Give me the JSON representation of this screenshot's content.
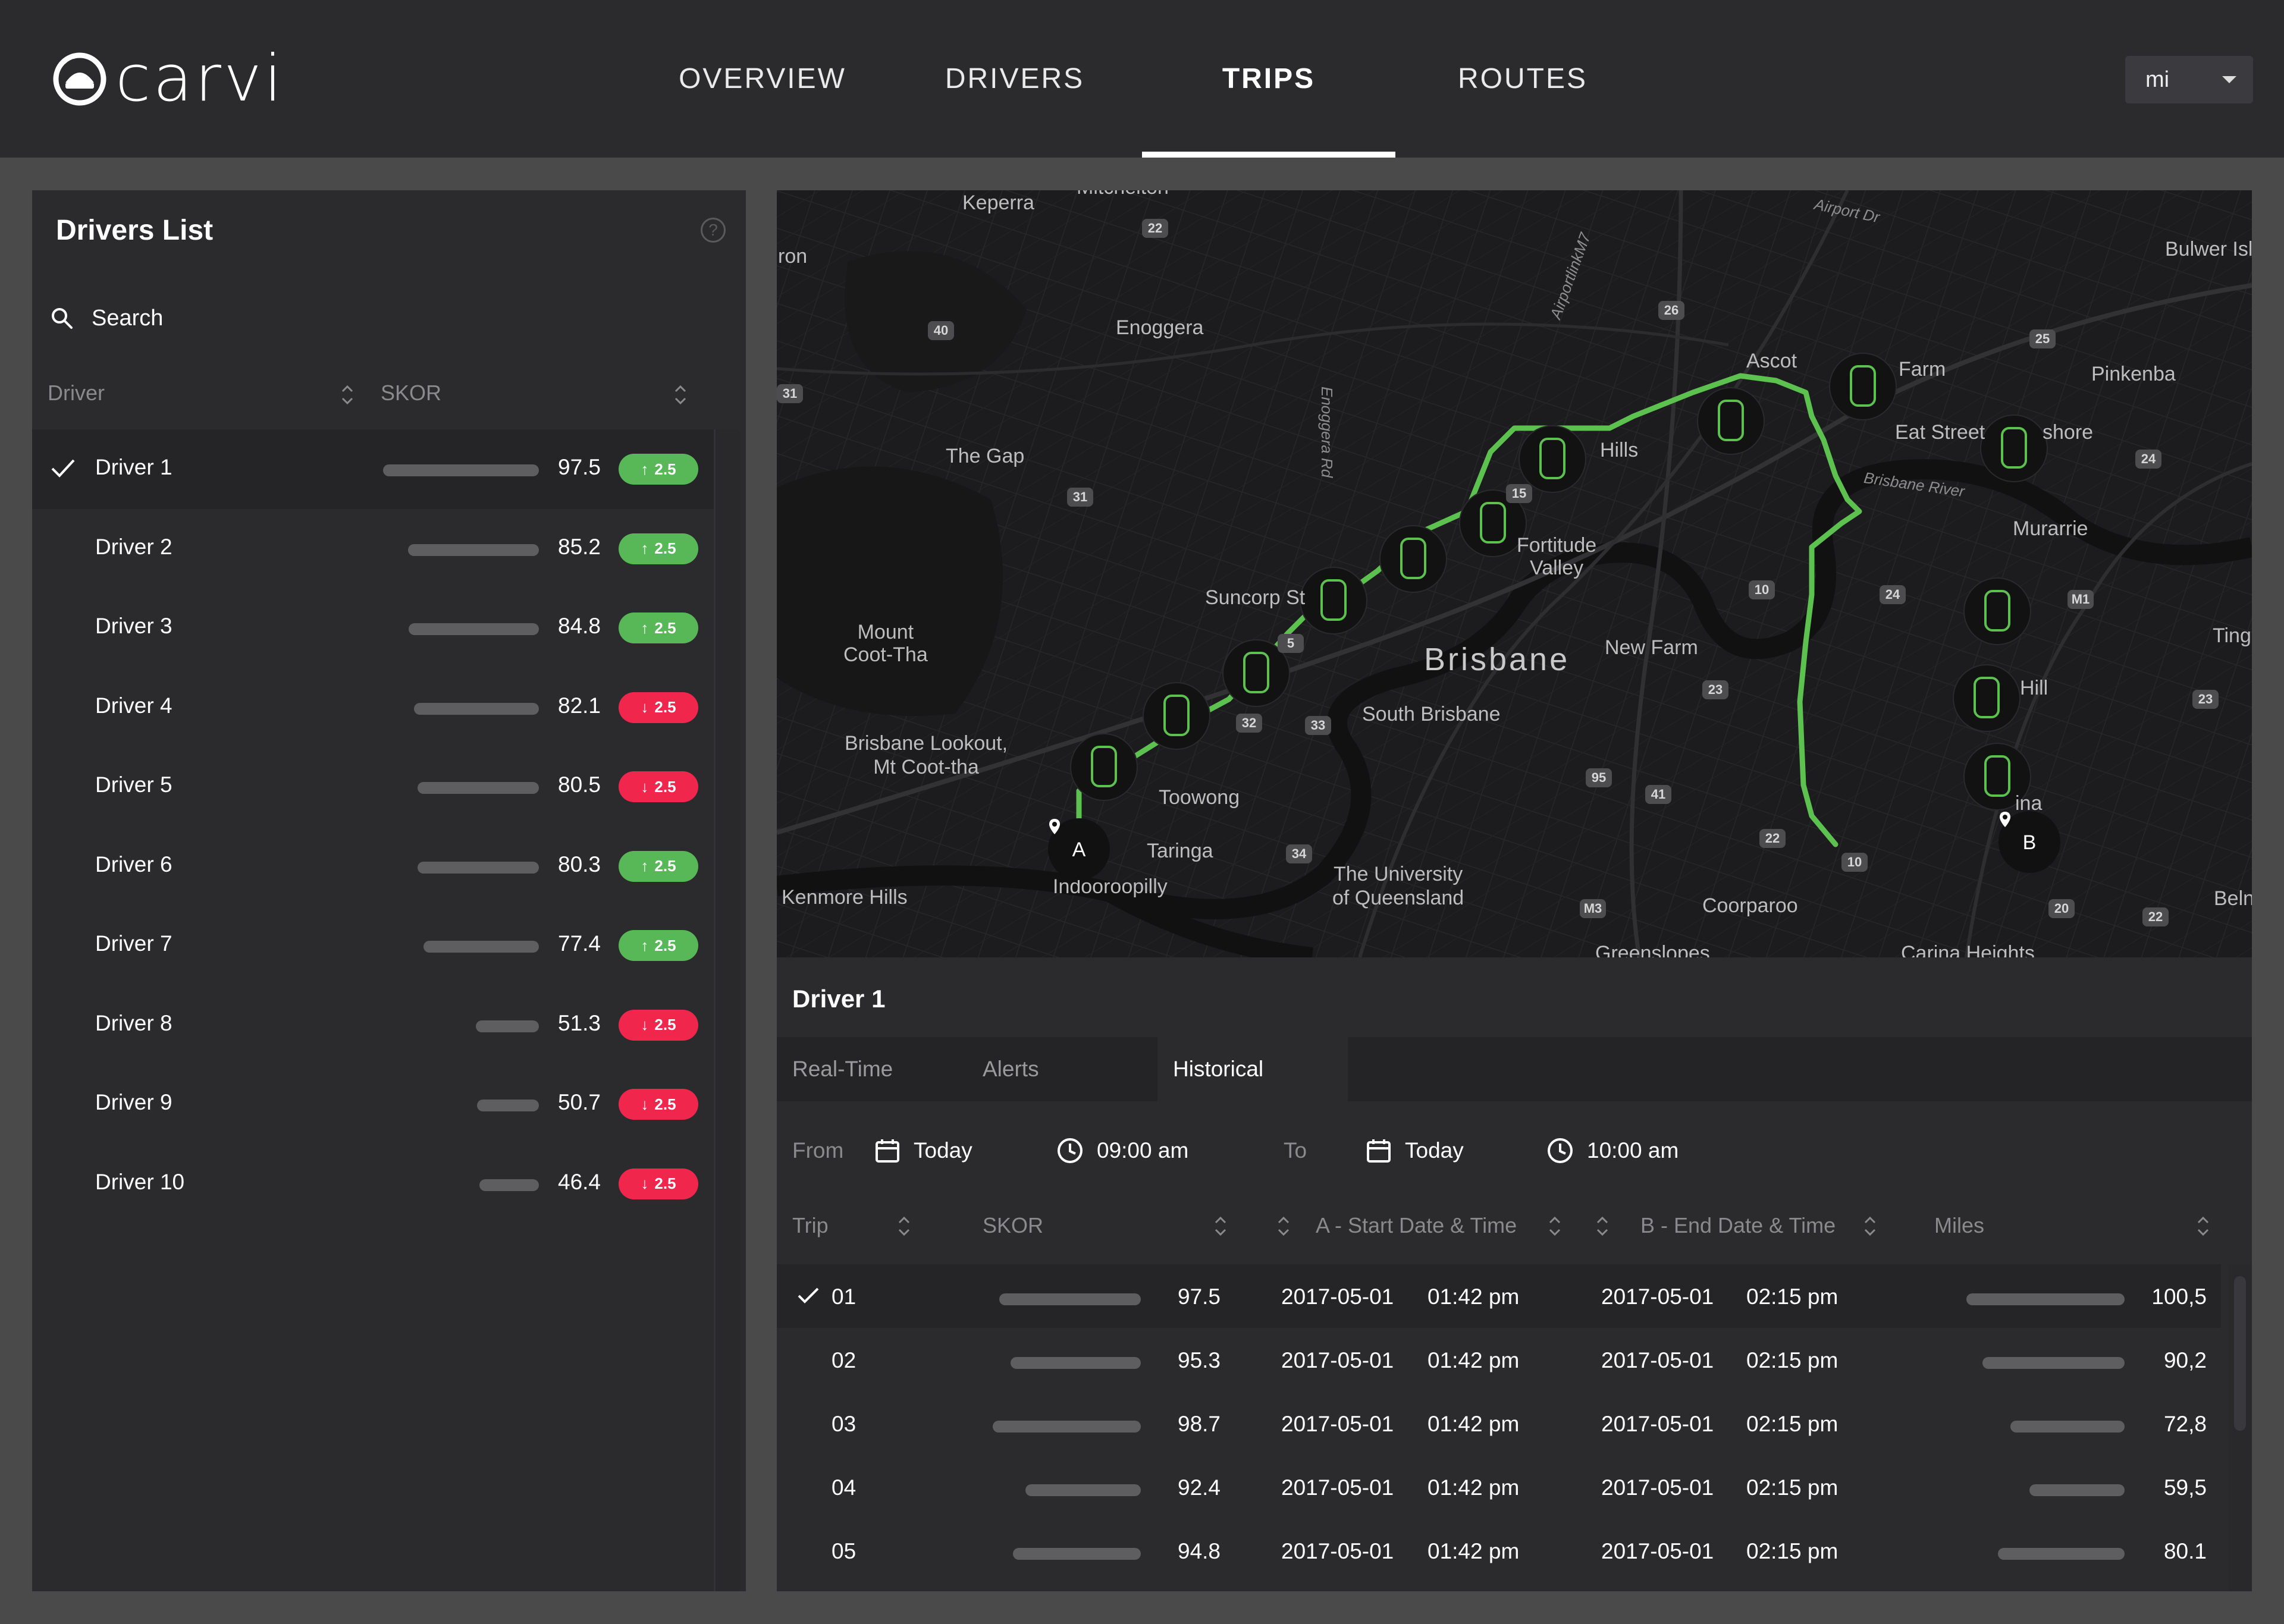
{
  "app": {
    "brand": "carvi"
  },
  "nav": {
    "items": [
      {
        "label": "OVERVIEW"
      },
      {
        "label": "DRIVERS"
      },
      {
        "label": "TRIPS",
        "active": true
      },
      {
        "label": "ROUTES"
      }
    ]
  },
  "unit_select": {
    "value": "mi"
  },
  "drivers_panel": {
    "title": "Drivers List",
    "help": "?",
    "search_label": "Search",
    "columns": {
      "driver": "Driver",
      "skor": "SKOR"
    },
    "drivers": [
      {
        "name": "Driver 1",
        "score": "97.5",
        "change": "2.5",
        "trend": "up",
        "selected": true,
        "bar": 0.975
      },
      {
        "name": "Driver 2",
        "score": "85.2",
        "change": "2.5",
        "trend": "up",
        "bar": 0.852
      },
      {
        "name": "Driver 3",
        "score": "84.8",
        "change": "2.5",
        "trend": "up",
        "bar": 0.848
      },
      {
        "name": "Driver 4",
        "score": "82.1",
        "change": "2.5",
        "trend": "down",
        "bar": 0.821
      },
      {
        "name": "Driver 5",
        "score": "80.5",
        "change": "2.5",
        "trend": "down",
        "bar": 0.805
      },
      {
        "name": "Driver 6",
        "score": "80.3",
        "change": "2.5",
        "trend": "up",
        "bar": 0.803
      },
      {
        "name": "Driver 7",
        "score": "77.4",
        "change": "2.5",
        "trend": "up",
        "bar": 0.774
      },
      {
        "name": "Driver 8",
        "score": "51.3",
        "change": "2.5",
        "trend": "down",
        "bar": 0.513
      },
      {
        "name": "Driver 9",
        "score": "50.7",
        "change": "2.5",
        "trend": "down",
        "bar": 0.507
      },
      {
        "name": "Driver 10",
        "score": "46.4",
        "change": "2.5",
        "trend": "down",
        "bar": 0.464
      }
    ]
  },
  "map": {
    "labels": [
      "Keperra",
      "Mitchelton",
      "ron",
      "Enoggera",
      "The Gap",
      "Mount\nCoot-Tha",
      "Suncorp St",
      "Brisbane",
      "South Brisbane",
      "Fortitude\nValley",
      "Hills",
      "Ascot",
      "Farm",
      "Eat Street",
      "shore",
      "Pinkenba",
      "Bulwer Isl",
      "New Farm",
      "Murarrie",
      "Ting",
      "Hill",
      "ina",
      "Brisbane Lookout,\nMt Coot-tha",
      "Toowong",
      "Taringa",
      "Indooroopilly",
      "Kenmore Hills",
      "The University\nof Queensland",
      "Coorparoo",
      "Greenslopes",
      "Carina Heights",
      "Beln"
    ],
    "road_labels": [
      "Enoggera Rd",
      "AirportlinkM7",
      "Airport Dr",
      "Brisbane River"
    ],
    "route_numbers": [
      "22",
      "40",
      "31",
      "26",
      "25",
      "24",
      "15",
      "31",
      "10",
      "24",
      "M1",
      "5",
      "32",
      "33",
      "23",
      "23",
      "95",
      "41",
      "22",
      "34",
      "10",
      "M3",
      "20",
      "22"
    ],
    "marker_a": "A",
    "marker_b": "B"
  },
  "trips_panel": {
    "driver_title": "Driver 1",
    "tabs": [
      {
        "label": "Real-Time"
      },
      {
        "label": "Alerts"
      },
      {
        "label": "Historical",
        "active": true
      }
    ],
    "filter": {
      "from_label": "From",
      "from_date": "Today",
      "from_time": "09:00 am",
      "to_label": "To",
      "to_date": "Today",
      "to_time": "10:00 am"
    },
    "columns": {
      "trip": "Trip",
      "skor": "SKOR",
      "start": "A - Start Date & Time",
      "end": "B - End Date & Time",
      "miles": "Miles"
    },
    "trips": [
      {
        "id": "01",
        "skor": "97.5",
        "start_date": "2017-05-01",
        "start_time": "01:42 pm",
        "end_date": "2017-05-01",
        "end_time": "02:15 pm",
        "miles": "100,5",
        "selected": true,
        "skor_bar": 0.975,
        "miles_bar": 1.0
      },
      {
        "id": "02",
        "skor": "95.3",
        "start_date": "2017-05-01",
        "start_time": "01:42 pm",
        "end_date": "2017-05-01",
        "end_time": "02:15 pm",
        "miles": "90,2",
        "skor_bar": 0.953,
        "miles_bar": 0.9
      },
      {
        "id": "03",
        "skor": "98.7",
        "start_date": "2017-05-01",
        "start_time": "01:42 pm",
        "end_date": "2017-05-01",
        "end_time": "02:15 pm",
        "miles": "72,8",
        "skor_bar": 0.987,
        "miles_bar": 0.72
      },
      {
        "id": "04",
        "skor": "92.4",
        "start_date": "2017-05-01",
        "start_time": "01:42 pm",
        "end_date": "2017-05-01",
        "end_time": "02:15 pm",
        "miles": "59,5",
        "skor_bar": 0.924,
        "miles_bar": 0.6
      },
      {
        "id": "05",
        "skor": "94.8",
        "start_date": "2017-05-01",
        "start_time": "01:42 pm",
        "end_date": "2017-05-01",
        "end_time": "02:15 pm",
        "miles": "80.1",
        "skor_bar": 0.948,
        "miles_bar": 0.8
      }
    ]
  },
  "colors": {
    "up": "#58b857",
    "down": "#f0264d",
    "route": "#5cc14f",
    "bg": "#2b2a2d"
  }
}
